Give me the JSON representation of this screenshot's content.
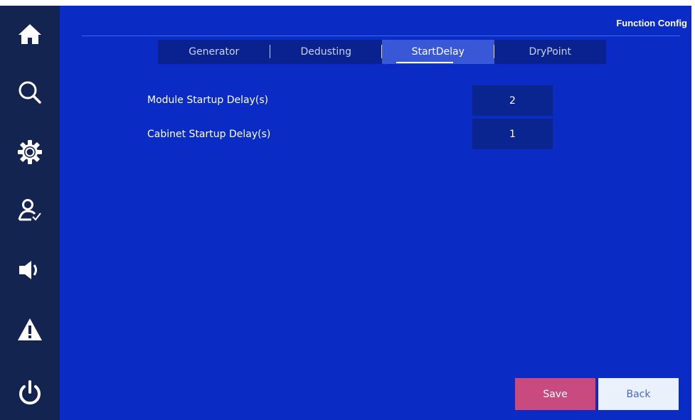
{
  "header": {
    "title": "Function Config"
  },
  "sidebar": {
    "items": [
      {
        "icon": "home-icon"
      },
      {
        "icon": "search-icon"
      },
      {
        "icon": "gear-icon"
      },
      {
        "icon": "user-check-icon"
      },
      {
        "icon": "speaker-icon"
      },
      {
        "icon": "warning-icon"
      },
      {
        "icon": "power-icon"
      }
    ]
  },
  "tabs": [
    {
      "label": "Generator",
      "active": false
    },
    {
      "label": "Dedusting",
      "active": false
    },
    {
      "label": "StartDelay",
      "active": true
    },
    {
      "label": "DryPoint",
      "active": false
    }
  ],
  "settings": {
    "module_startup_delay": {
      "label": "Module Startup Delay(s)",
      "value": "2"
    },
    "cabinet_startup_delay": {
      "label": "Cabinet Startup Delay(s)",
      "value": "1"
    }
  },
  "actions": {
    "save_label": "Save",
    "back_label": "Back"
  },
  "colors": {
    "sidebar_bg": "#142450",
    "main_bg": "#0a2cc4",
    "active_tab": "#3858d8",
    "save_button": "#c84a7e",
    "back_button": "#eaf1fb"
  }
}
